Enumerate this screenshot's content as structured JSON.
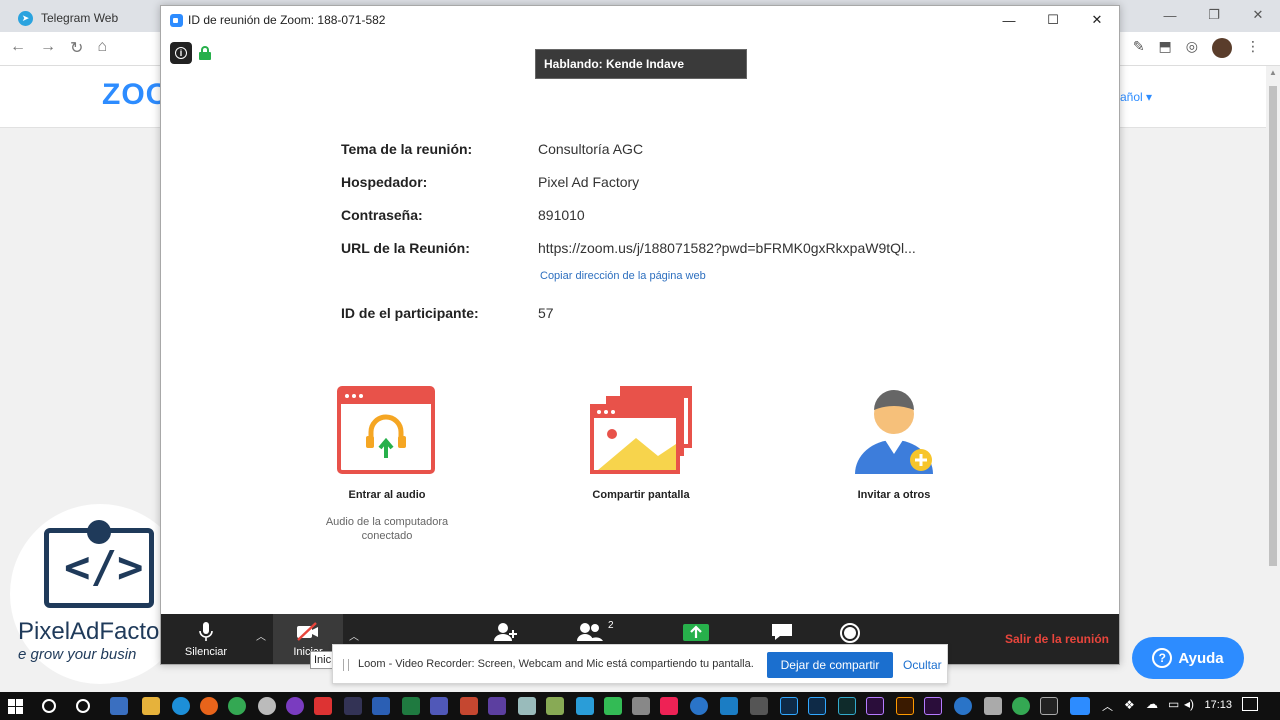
{
  "browser": {
    "tab_title": "Telegram Web",
    "page_logo": "ZOO",
    "language": "añol"
  },
  "watermark": {
    "name": "PixelAdFacto",
    "tagline": "e grow your busin",
    "code": "</>"
  },
  "help_button": {
    "label": "Ayuda"
  },
  "zoom_window": {
    "title": "ID de reunión de Zoom: 188-071-582",
    "speaking": "Hablando: Kende Indave",
    "info": {
      "topic_label": "Tema de la reunión:",
      "topic_value": "Consultoría AGC",
      "host_label": "Hospedador:",
      "host_value": "Pixel Ad Factory",
      "password_label": "Contraseña:",
      "password_value": "891010",
      "url_label": "URL de la Reunión:",
      "url_value": "https://zoom.us/j/188071582?pwd=bFRMK0gxRkxpaW9tQl...",
      "copy_link": "Copiar dirección de la página web",
      "participant_label": "ID de el participante:",
      "participant_value": "57"
    },
    "actions": {
      "audio_label": "Entrar al audio",
      "audio_sub": "Audio de la computadora conectado",
      "share_label": "Compartir pantalla",
      "invite_label": "Invitar a otros"
    },
    "toolbar": {
      "mute_label": "Silenciar",
      "video_label": "Iniciar",
      "participants_count": "2",
      "exit_label": "Salir de la reunión"
    },
    "tooltip": "Inic"
  },
  "loom_banner": {
    "text": "Loom - Video Recorder: Screen, Webcam and Mic está compartiendo tu pantalla.",
    "stop_label": "Dejar de compartir",
    "hide_label": "Ocultar"
  },
  "taskbar": {
    "time": "17:13"
  },
  "colors": {
    "zoom_blue": "#2d8cff",
    "exit_red": "#e8453c",
    "share_green": "#27b04b",
    "loom_blue": "#1b6fcf"
  }
}
